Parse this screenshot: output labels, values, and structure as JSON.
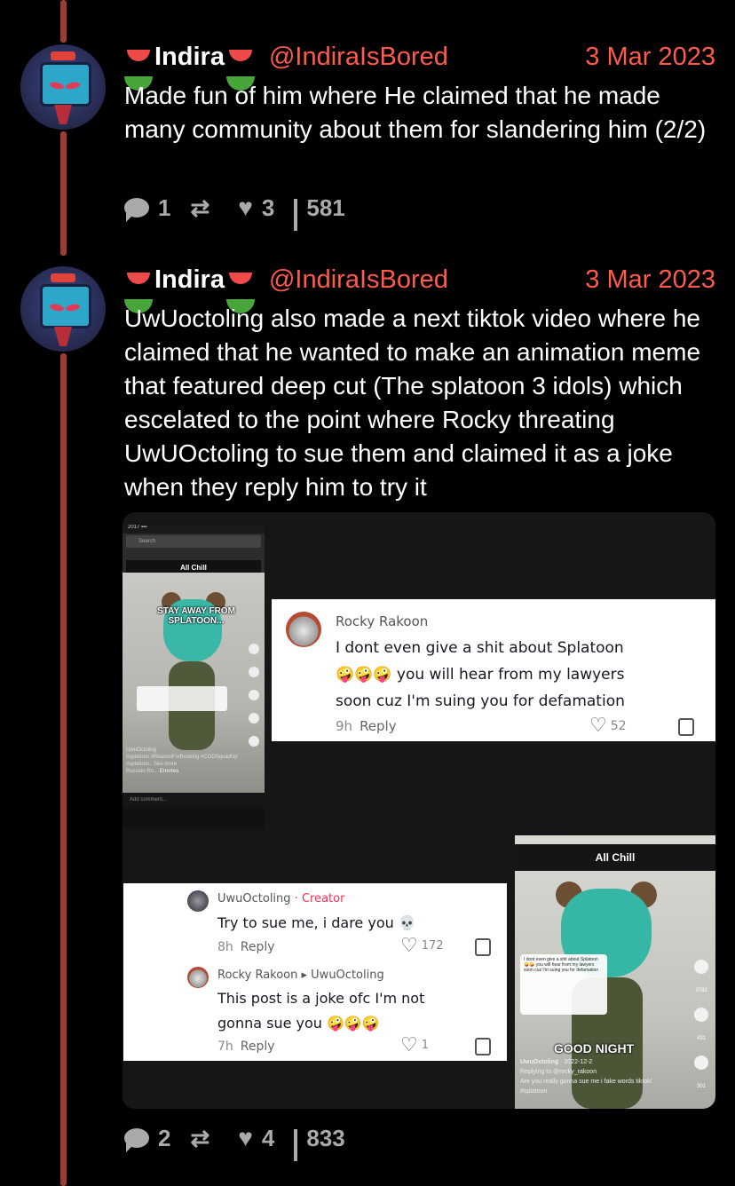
{
  "tweets": [
    {
      "display_name": "Indira",
      "handle": "@IndiraIsBored",
      "date": "3 Mar 2023",
      "text": "Made fun of him where He claimed that he made many community about them for slandering him (2/2)",
      "replies": "1",
      "likes": "3",
      "views": "581"
    },
    {
      "display_name": "Indira",
      "handle": "@IndiraIsBored",
      "date": "3 Mar 2023",
      "text": "UwUoctoling also made a next tiktok video where he claimed that he wanted to make an animation meme that featured deep cut (The splatoon 3 idols) which escelated to the point where Rocky threating UwUOctoling to sue them and claimed it as a joke when they reply him to try it",
      "replies": "2",
      "likes": "4",
      "views": "833"
    }
  ],
  "media": {
    "phone1": {
      "search_placeholder": "Search",
      "banner": "All Chill",
      "overlay": "STAY AWAY FROM SPLATOON...",
      "caption_user": "UwuOctoling",
      "caption_tags": "#splatoon #ReasonForBooking #CODSquadUp #splatoon.. See more",
      "music": "Russian Ro...",
      "emotes": "Emotes",
      "add_comment": "Add comment..."
    },
    "rocky_comment": {
      "user": "Rocky Rakoon",
      "line1": "I dont even give a shit about Splatoon",
      "emoji": "🤪🤪🤪",
      "line2": " you will hear from my lawyers",
      "line3": "soon cuz I'm suing you for defamation",
      "time": "9h",
      "reply": "Reply",
      "likes": "52"
    },
    "thread_comments": {
      "uwu_user": "UwuOctoling",
      "creator_tag": " · Creator",
      "uwu_text": "Try to sue me, i dare you 💀",
      "uwu_time": "8h",
      "reply": "Reply",
      "uwu_likes": "172",
      "rocky_user": "Rocky Rakoon",
      "reply_arrow": " ▸ ",
      "reply_to": "UwuOctoling",
      "rocky_text1": "This post is a joke ofc I'm not",
      "rocky_text2": "gonna sue you 🤪🤪🤪",
      "rocky_time": "7h",
      "rocky_likes": "1"
    },
    "phone2": {
      "banner": "All Chill",
      "good_night": "GOOD NIGHT",
      "cap_user": "UwuOctoling",
      "cap_date": " · 2022-12-2",
      "cap_reply": "Replying to @rocky_rakoon",
      "cap_text": "Are you really gonna sue me i fake words tiktok! #splatoon",
      "bubble_text": "I dont even give a shit about Splatoon 🤪🤪 you will hear from my lawyers soon cuz I'm suing you for defamation",
      "likes": "3782",
      "comments": "431",
      "saves": "301"
    }
  }
}
